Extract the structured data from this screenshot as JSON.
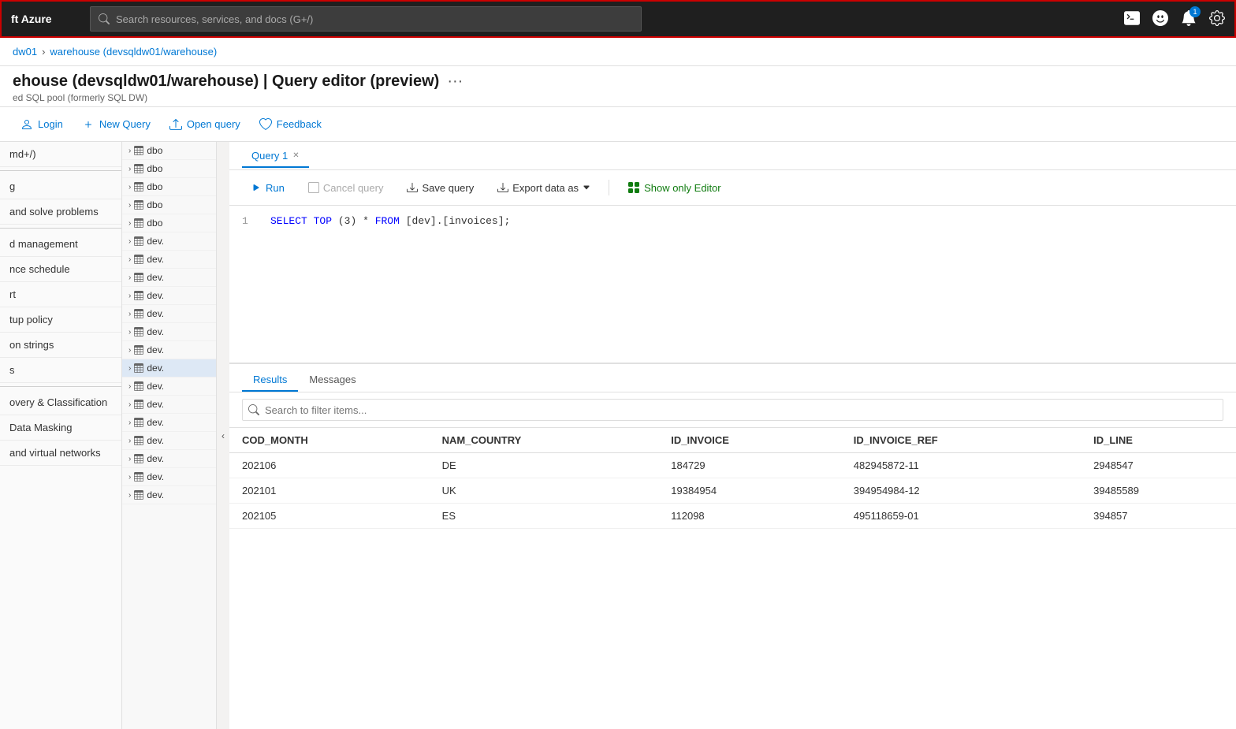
{
  "topbar": {
    "title": "ft Azure",
    "search_placeholder": "Search resources, services, and docs (G+/)",
    "notification_count": "1"
  },
  "breadcrumb": {
    "parent": "dw01",
    "current": "warehouse (devsqldw01/warehouse)"
  },
  "page": {
    "title": "ehouse (devsqldw01/warehouse) | Query editor (preview)",
    "subtitle": "ed SQL pool (formerly SQL DW)",
    "more_label": "···"
  },
  "toolbar": {
    "login_label": "Login",
    "new_query_label": "New Query",
    "open_query_label": "Open query",
    "feedback_label": "Feedback"
  },
  "sidebar_nav": {
    "items": [
      {
        "label": "md+/)"
      },
      {
        "label": "g"
      },
      {
        "label": "and solve problems"
      },
      {
        "label": "d management"
      },
      {
        "label": "nce schedule"
      },
      {
        "label": "rt"
      },
      {
        "label": "tup policy"
      },
      {
        "label": "on strings"
      },
      {
        "label": "s"
      },
      {
        "label": "overy & Classification"
      },
      {
        "label": "Data Masking"
      },
      {
        "label": "and virtual networks"
      }
    ]
  },
  "tree": {
    "items": [
      {
        "label": "dbo",
        "selected": false
      },
      {
        "label": "dbo",
        "selected": false
      },
      {
        "label": "dbo",
        "selected": false
      },
      {
        "label": "dbo",
        "selected": false
      },
      {
        "label": "dbo",
        "selected": false
      },
      {
        "label": "dev.",
        "selected": false
      },
      {
        "label": "dev.",
        "selected": false
      },
      {
        "label": "dev.",
        "selected": false
      },
      {
        "label": "dev.",
        "selected": false
      },
      {
        "label": "dev.",
        "selected": false
      },
      {
        "label": "dev.",
        "selected": false
      },
      {
        "label": "dev.",
        "selected": false
      },
      {
        "label": "dev.",
        "selected": true
      },
      {
        "label": "dev.",
        "selected": false
      },
      {
        "label": "dev.",
        "selected": false
      },
      {
        "label": "dev.",
        "selected": false
      },
      {
        "label": "dev.",
        "selected": false
      },
      {
        "label": "dev.",
        "selected": false
      },
      {
        "label": "dev.",
        "selected": false
      },
      {
        "label": "dev.",
        "selected": false
      }
    ]
  },
  "query_editor": {
    "tab_label": "Query 1",
    "run_label": "Run",
    "cancel_label": "Cancel query",
    "save_label": "Save query",
    "export_label": "Export data as",
    "show_editor_label": "Show only Editor",
    "code_line1": "SELECT TOP (3) * FROM [dev].[invoices];",
    "line_number": "1"
  },
  "results": {
    "results_tab": "Results",
    "messages_tab": "Messages",
    "search_placeholder": "Search to filter items...",
    "columns": [
      "COD_MONTH",
      "NAM_COUNTRY",
      "ID_INVOICE",
      "ID_INVOICE_REF",
      "ID_LINE"
    ],
    "rows": [
      [
        "202106",
        "DE",
        "184729",
        "482945872-11",
        "2948547"
      ],
      [
        "202101",
        "UK",
        "19384954",
        "394954984-12",
        "39485589"
      ],
      [
        "202105",
        "ES",
        "112098",
        "495118659-01",
        "394857"
      ]
    ]
  }
}
